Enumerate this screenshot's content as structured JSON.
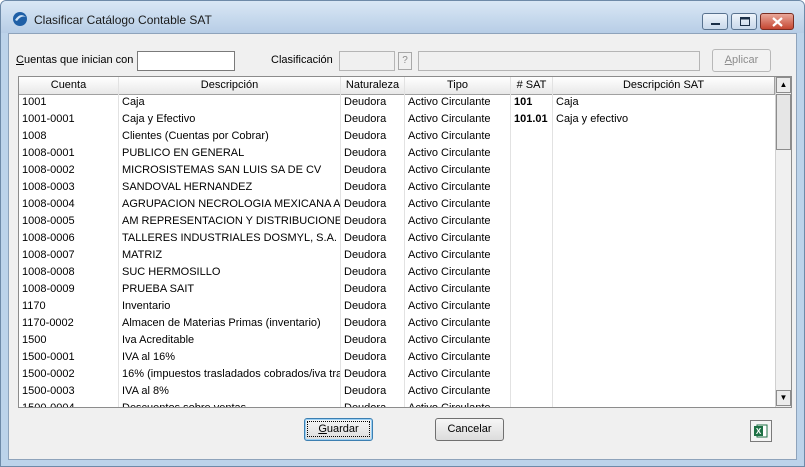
{
  "window": {
    "title": "Clasificar Catálogo Contable SAT"
  },
  "filter": {
    "cuentas_label_u": "C",
    "cuentas_label_rest": "uentas que inician con",
    "cuentas_value": "",
    "clasificacion_label": "Clasificación",
    "help_glyph": "?",
    "aplicar_u": "A",
    "aplicar_rest": "plicar"
  },
  "grid": {
    "columns": [
      "Cuenta",
      "Descripción",
      "Naturaleza",
      "Tipo",
      "# SAT",
      "Descripción SAT"
    ],
    "rows": [
      [
        "1001",
        "Caja",
        "Deudora",
        "Activo Circulante",
        "101",
        "Caja"
      ],
      [
        "1001-0001",
        "Caja y Efectivo",
        "Deudora",
        "Activo Circulante",
        "101.01",
        "Caja y efectivo"
      ],
      [
        "1008",
        "Clientes (Cuentas por Cobrar)",
        "Deudora",
        "Activo Circulante",
        "",
        ""
      ],
      [
        "1008-0001",
        "PUBLICO EN GENERAL",
        "Deudora",
        "Activo Circulante",
        "",
        ""
      ],
      [
        "1008-0002",
        "MICROSISTEMAS SAN LUIS SA DE CV",
        "Deudora",
        "Activo Circulante",
        "",
        ""
      ],
      [
        "1008-0003",
        "SANDOVAL HERNANDEZ",
        "Deudora",
        "Activo Circulante",
        "",
        ""
      ],
      [
        "1008-0004",
        "AGRUPACION NECROLOGIA MEXICANA AC",
        "Deudora",
        "Activo Circulante",
        "",
        ""
      ],
      [
        "1008-0005",
        "AM REPRESENTACION Y DISTRIBUCIONES DE",
        "Deudora",
        "Activo Circulante",
        "",
        ""
      ],
      [
        "1008-0006",
        "TALLERES INDUSTRIALES DOSMYL, S.A. DE",
        "Deudora",
        "Activo Circulante",
        "",
        ""
      ],
      [
        "1008-0007",
        "MATRIZ",
        "Deudora",
        "Activo Circulante",
        "",
        ""
      ],
      [
        "1008-0008",
        "SUC HERMOSILLO",
        "Deudora",
        "Activo Circulante",
        "",
        ""
      ],
      [
        "1008-0009",
        "PRUEBA SAIT",
        "Deudora",
        "Activo Circulante",
        "",
        ""
      ],
      [
        "1170",
        "Inventario",
        "Deudora",
        "Activo Circulante",
        "",
        ""
      ],
      [
        "1170-0002",
        "Almacen de Materias Primas (inventario)",
        "Deudora",
        "Activo Circulante",
        "",
        ""
      ],
      [
        "1500",
        "Iva Acreditable",
        "Deudora",
        "Activo Circulante",
        "",
        ""
      ],
      [
        "1500-0001",
        "IVA al 16%",
        "Deudora",
        "Activo Circulante",
        "",
        ""
      ],
      [
        "1500-0002",
        "16% (impuestos trasladados cobrados/iva tra",
        "Deudora",
        "Activo Circulante",
        "",
        ""
      ],
      [
        "1500-0003",
        "IVA al 8%",
        "Deudora",
        "Activo Circulante",
        "",
        ""
      ],
      [
        "1500-0004",
        "Descuentos sobre ventas",
        "Deudora",
        "Activo Circulante",
        "",
        ""
      ]
    ]
  },
  "footer": {
    "guardar_u": "G",
    "guardar_rest": "uardar",
    "cancelar": "Cancelar",
    "excel_glyph": "X"
  }
}
